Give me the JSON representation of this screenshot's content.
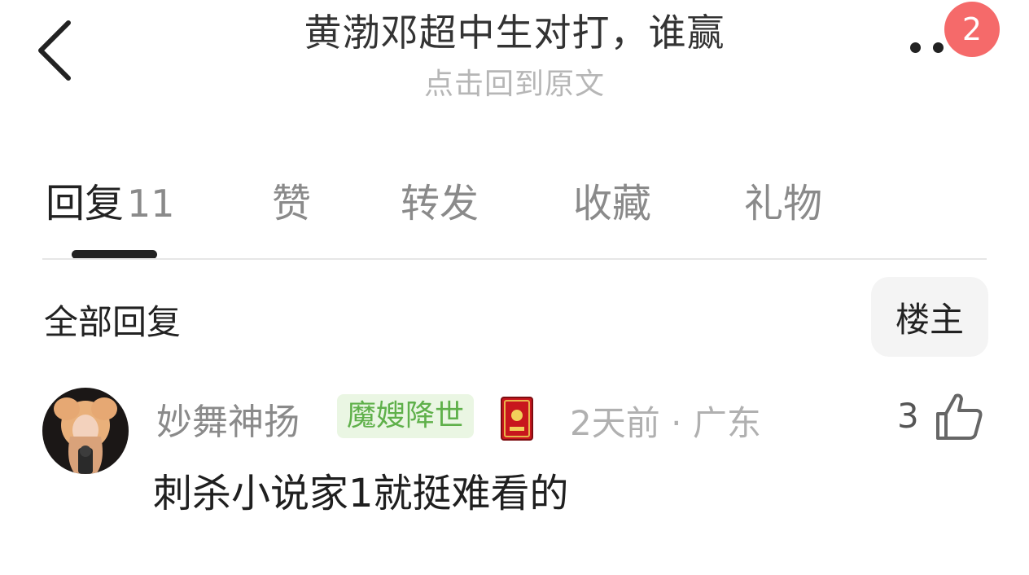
{
  "header": {
    "title": "黄渤邓超中生对打，谁赢",
    "subtitle": "点击回到原文",
    "badge_count": "2",
    "back_icon": "chevron-left-icon",
    "more_icon": "more-dots-icon"
  },
  "tabs": [
    {
      "label": "回复",
      "count": "11",
      "active": true
    },
    {
      "label": "赞",
      "count": "",
      "active": false
    },
    {
      "label": "转发",
      "count": "",
      "active": false
    },
    {
      "label": "收藏",
      "count": "",
      "active": false
    },
    {
      "label": "礼物",
      "count": "",
      "active": false
    }
  ],
  "section": {
    "title": "全部回复",
    "filter_label": "楼主"
  },
  "replies": [
    {
      "username": "妙舞神扬",
      "tag": "魔嫂降世",
      "medal_icon": "red-book-medal-icon",
      "time": "2天前",
      "separator": "·",
      "location": "广东",
      "like_count": "3",
      "like_icon": "thumbs-up-icon",
      "text": "刺杀小说家1就挺难看的"
    }
  ],
  "colors": {
    "badge": "#f56a6a",
    "tag_bg": "#eaf6e3",
    "tag_text": "#5fb04a",
    "muted": "#8a8a8a"
  }
}
